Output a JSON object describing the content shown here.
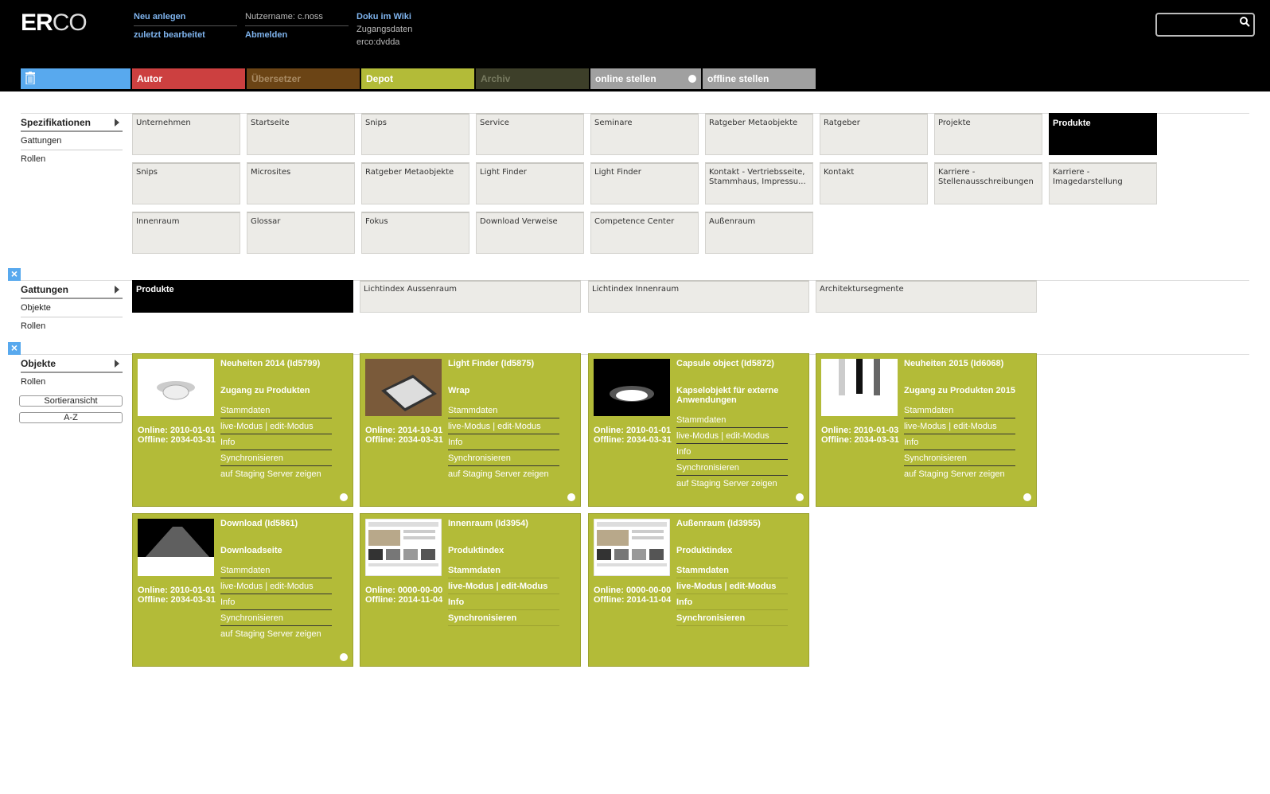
{
  "header": {
    "logo_bold": "ER",
    "logo_light": "CO",
    "new_link": "Neu anlegen",
    "recent_link": "zuletzt bearbeitet",
    "username": "Nutzername: c.noss",
    "logout": "Abmelden",
    "wiki": "Doku im Wiki",
    "access_label": "Zugangsdaten",
    "access_value": "erco:dvdda",
    "search_placeholder": ""
  },
  "tabs": {
    "trash": "trash-icon",
    "autor": "Autor",
    "uebersetzer": "Übersetzer",
    "depot": "Depot",
    "archiv": "Archiv",
    "online": "online stellen",
    "offline": "offline stellen"
  },
  "colors": {
    "blue": "#58a9ee",
    "red": "#cc4040",
    "green": "#b3bb38"
  },
  "spezifikationen": {
    "side": [
      "Spezifikationen",
      "Gattungen",
      "Rollen"
    ],
    "tiles": [
      "Unternehmen",
      "Startseite",
      "Snips",
      "Service",
      "Seminare",
      "Ratgeber Metaobjekte",
      "Ratgeber",
      "Projekte",
      "Produkte",
      "Snips",
      "Microsites",
      "Ratgeber Metaobjekte",
      "Light Finder",
      "Light Finder",
      "Kontakt - Vertriebsseite, Stammhaus, Impressu...",
      "Kontakt",
      "Karriere - Stellenausschreibungen",
      "Karriere - Imagedarstellung",
      "Innenraum",
      "Glossar",
      "Fokus",
      "Download Verweise",
      "Competence Center",
      "Außenraum"
    ]
  },
  "gattungen": {
    "side": [
      "Gattungen",
      "Objekte",
      "Rollen"
    ],
    "tiles": [
      "Produkte",
      "Lichtindex Aussenraum",
      "Lichtindex Innenraum",
      "Architektursegmente"
    ]
  },
  "objekte": {
    "side": [
      "Objekte",
      "Rollen"
    ],
    "sort_button": "Sortieransicht",
    "az_button": "A-Z",
    "cards": [
      {
        "title": "Neuheiten 2014 (Id5799)",
        "sub": "Zugang zu Produkten",
        "online": "Online: 2010-01-01",
        "offline": "Offline: 2034-03-31",
        "stamm": "Stammdaten",
        "live": "live-Modus",
        "edit": "edit-Modus",
        "info": "Info",
        "sync": "Synchronisieren",
        "staging": "auf Staging Server zeigen"
      },
      {
        "title": "Light Finder (Id5875)",
        "sub": "Wrap",
        "online": "Online: 2014-10-01",
        "offline": "Offline: 2034-03-31",
        "stamm": "Stammdaten",
        "live": "live-Modus",
        "edit": "edit-Modus",
        "info": "Info",
        "sync": "Synchronisieren",
        "staging": "auf Staging Server zeigen"
      },
      {
        "title": "Capsule object (Id5872)",
        "sub": "Kapselobjekt für externe Anwendungen",
        "online": "Online: 2010-01-01",
        "offline": "Offline: 2034-03-31",
        "stamm": "Stammdaten",
        "live": "live-Modus",
        "edit": "edit-Modus",
        "info": "Info",
        "sync": "Synchronisieren",
        "staging": "auf Staging Server zeigen"
      },
      {
        "title": "Neuheiten 2015 (Id6068)",
        "sub": "Zugang zu Produkten 2015",
        "online": "Online: 2010-01-03",
        "offline": "Offline: 2034-03-31",
        "stamm": "Stammdaten",
        "live": "live-Modus",
        "edit": "edit-Modus",
        "info": "Info",
        "sync": "Synchronisieren",
        "staging": "auf Staging Server zeigen"
      },
      {
        "title": "Download (Id5861)",
        "sub": "Downloadseite",
        "online": "Online: 2010-01-01",
        "offline": "Offline: 2034-03-31",
        "stamm": "Stammdaten",
        "live": "live-Modus",
        "edit": "edit-Modus",
        "info": "Info",
        "sync": "Synchronisieren",
        "staging": "auf Staging Server zeigen"
      },
      {
        "title": "Innenraum (Id3954)",
        "sub": "Produktindex",
        "online": "Online: 0000-00-00",
        "offline": "Offline: 2014-11-04",
        "stamm": "Stammdaten",
        "live": "live-Modus",
        "edit": "edit-Modus",
        "info": "Info",
        "sync": "Synchronisieren"
      },
      {
        "title": "Außenraum (Id3955)",
        "sub": "Produktindex",
        "online": "Online: 0000-00-00",
        "offline": "Offline: 2014-11-04",
        "stamm": "Stammdaten",
        "live": "live-Modus",
        "edit": "edit-Modus",
        "info": "Info",
        "sync": "Synchronisieren"
      }
    ]
  }
}
